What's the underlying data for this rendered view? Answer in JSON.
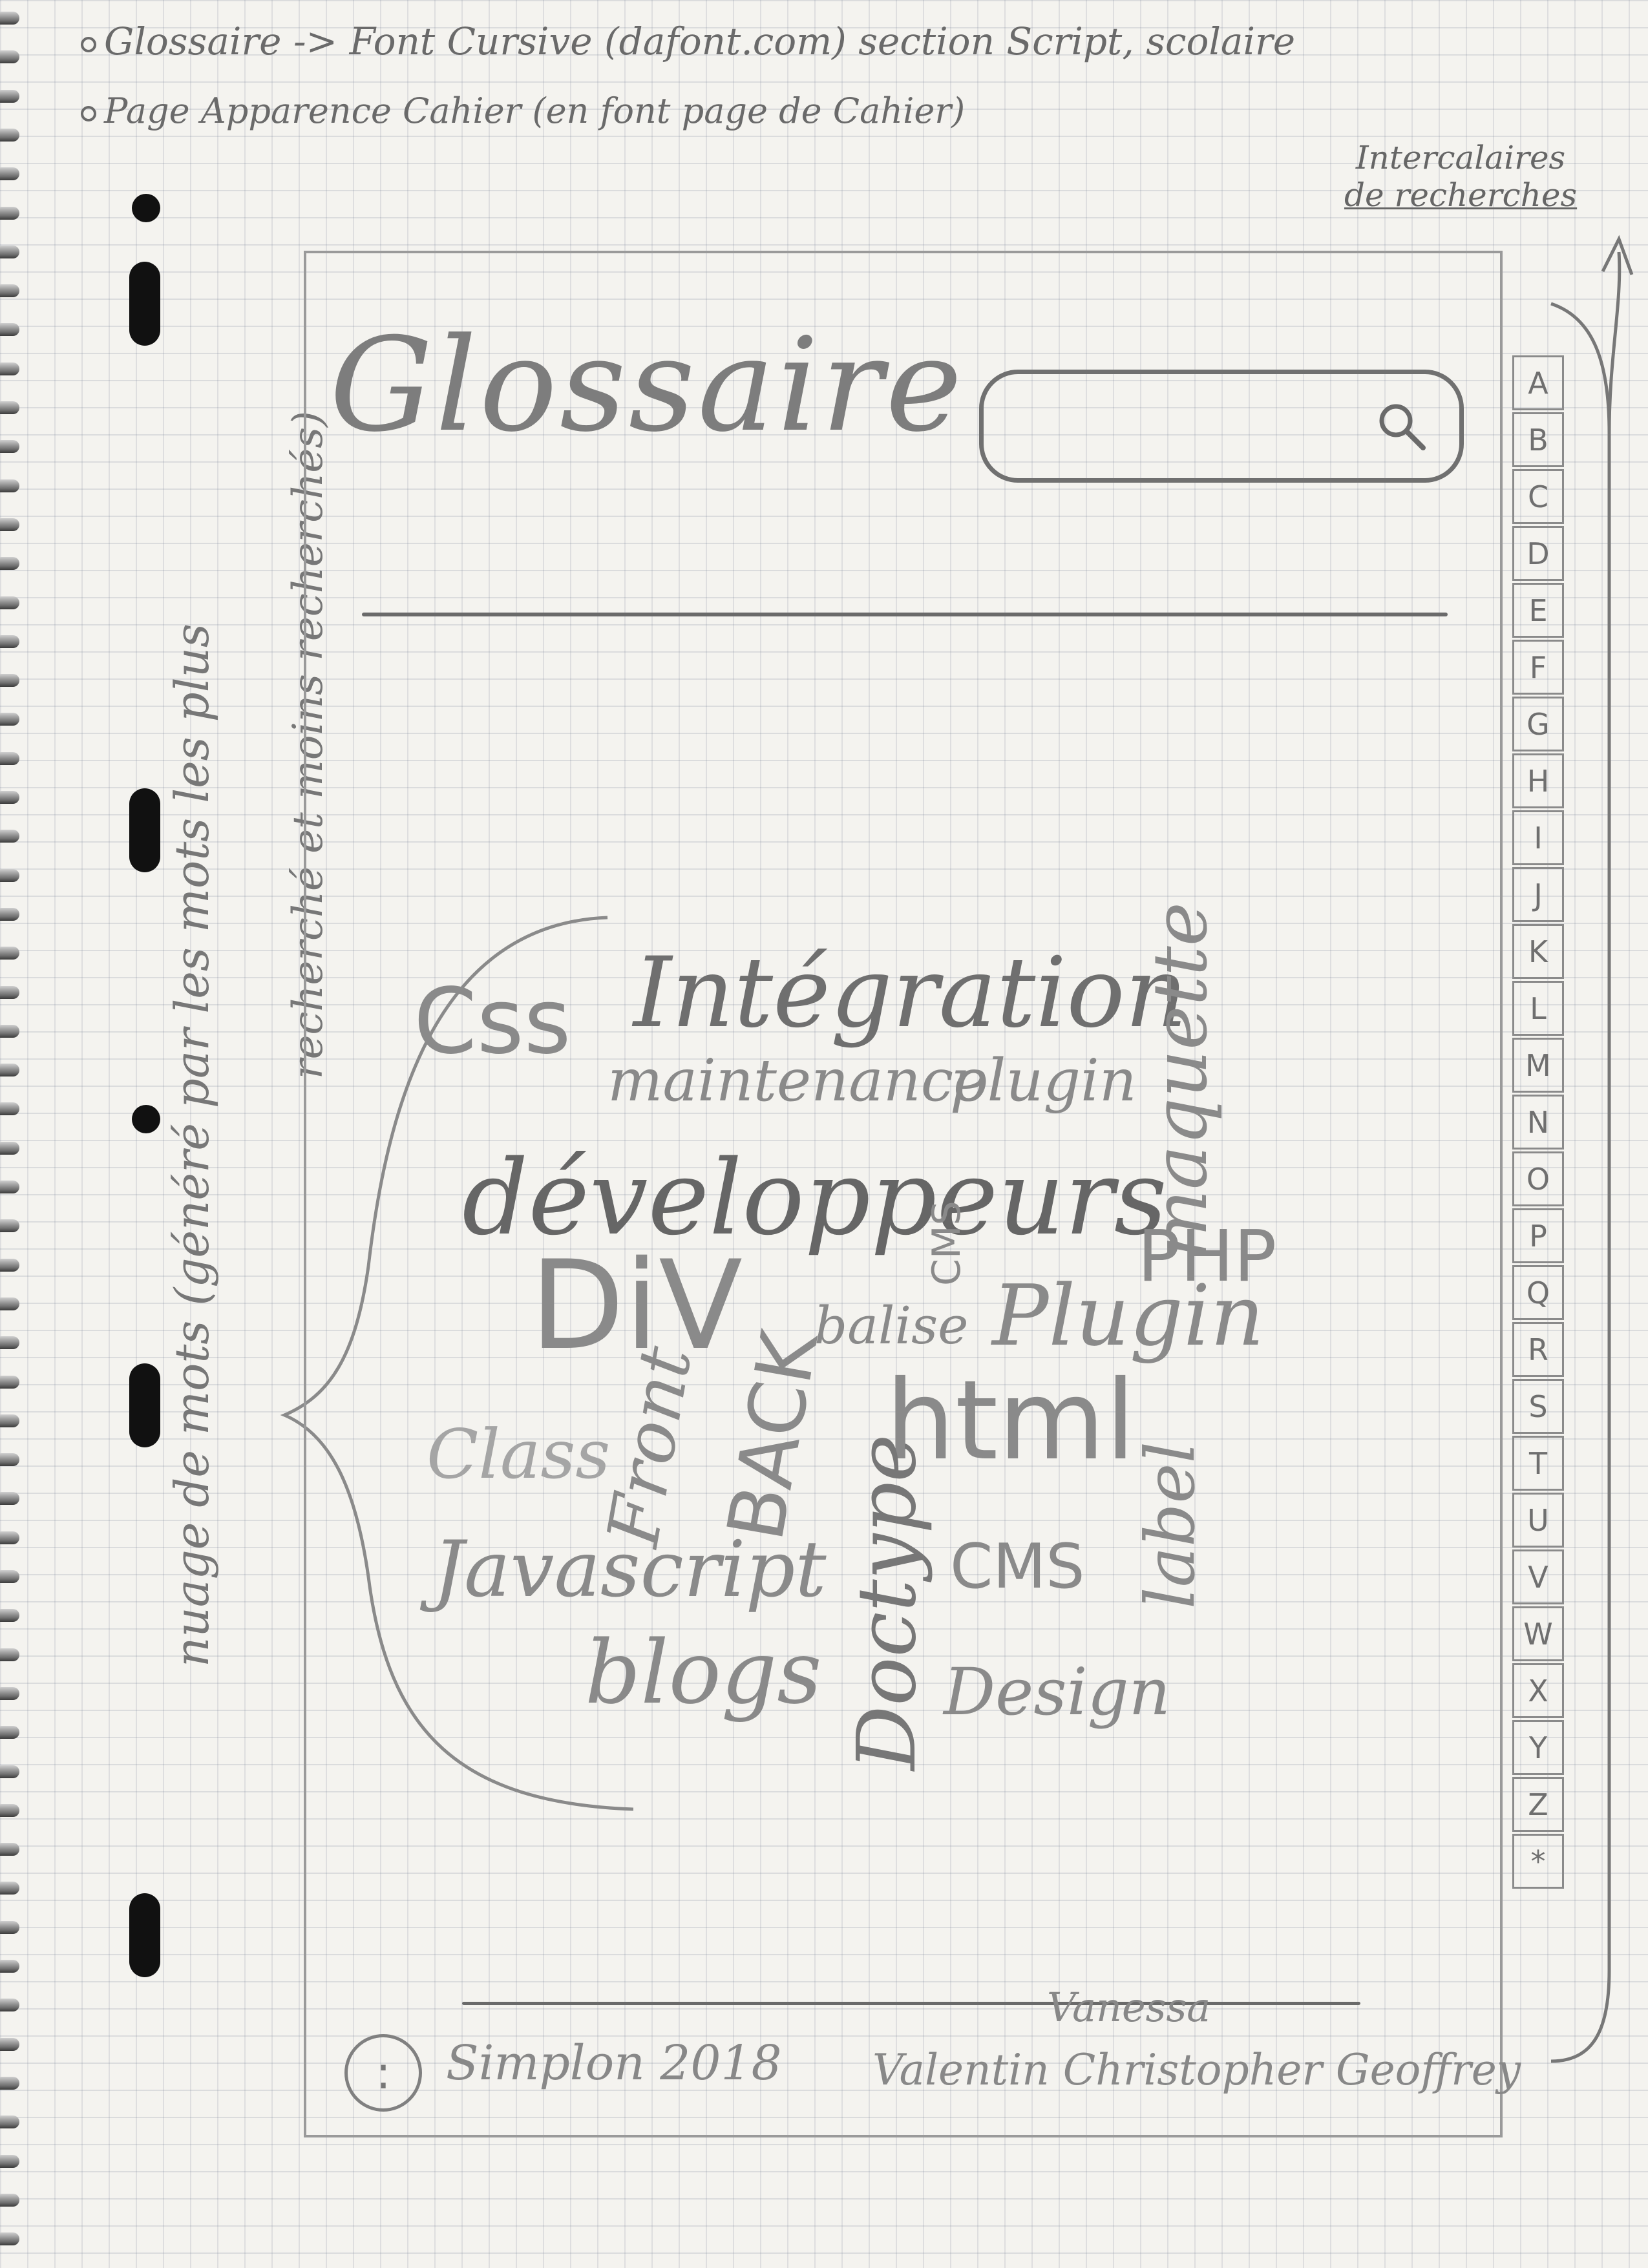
{
  "notes": {
    "line1": "Glossaire -> Font Cursive (dafont.com) section Script, scolaire",
    "line2": "Page Apparence Cahier (en font page de Cahier)"
  },
  "annotation": {
    "line1": "Intercalaires",
    "line2": "de recherches"
  },
  "side_label": {
    "line1": "nuage de mots (généré par les mots les plus",
    "line2": "recherché et moins recherchés)"
  },
  "header": {
    "logo": "Glossaire",
    "search_icon": "search-icon"
  },
  "word_cloud": [
    {
      "text": "Css"
    },
    {
      "text": "Intégration"
    },
    {
      "text": "maintenance"
    },
    {
      "text": "plugin"
    },
    {
      "text": "développeurs"
    },
    {
      "text": "DiV"
    },
    {
      "text": "CMS"
    },
    {
      "text": "balise"
    },
    {
      "text": "Plugin"
    },
    {
      "text": "maquette"
    },
    {
      "text": "PHP"
    },
    {
      "text": "Class"
    },
    {
      "text": "Front"
    },
    {
      "text": "BACK"
    },
    {
      "text": "html"
    },
    {
      "text": "label"
    },
    {
      "text": "Doctype"
    },
    {
      "text": "Javascript"
    },
    {
      "text": "CMS"
    },
    {
      "text": "blogs"
    },
    {
      "text": "Design"
    }
  ],
  "alphabet_tabs": [
    "A",
    "B",
    "C",
    "D",
    "E",
    "F",
    "G",
    "H",
    "I",
    "J",
    "K",
    "L",
    "M",
    "N",
    "O",
    "P",
    "Q",
    "R",
    "S",
    "T",
    "U",
    "V",
    "W",
    "X",
    "Y",
    "Z",
    "*"
  ],
  "footer": {
    "icon": ":",
    "org": "Simplon 2018",
    "team_top": "Vanessa",
    "team": "Valentin Christopher Geoffrey"
  }
}
